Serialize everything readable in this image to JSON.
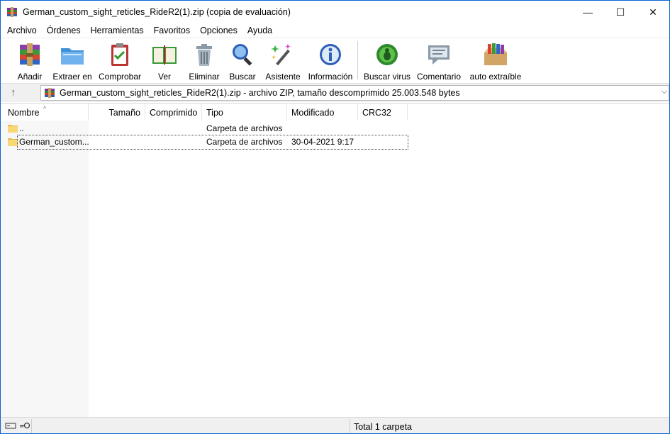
{
  "window": {
    "title": "German_custom_sight_reticles_RideR2(1).zip (copia de evaluación)",
    "controls": {
      "minimize": "—",
      "maximize": "☐",
      "close": "✕"
    }
  },
  "menu": [
    "Archivo",
    "Órdenes",
    "Herramientas",
    "Favoritos",
    "Opciones",
    "Ayuda"
  ],
  "toolbar": [
    {
      "label": "Añadir",
      "icon": "add-archive-icon"
    },
    {
      "label": "Extraer en",
      "icon": "extract-folder-icon"
    },
    {
      "label": "Comprobar",
      "icon": "test-clipboard-icon"
    },
    {
      "label": "Ver",
      "icon": "view-book-icon"
    },
    {
      "label": "Eliminar",
      "icon": "trash-icon"
    },
    {
      "label": "Buscar",
      "icon": "magnifier-icon"
    },
    {
      "label": "Asistente",
      "icon": "wizard-wand-icon"
    },
    {
      "label": "Información",
      "icon": "info-icon"
    },
    {
      "label": "Buscar virus",
      "icon": "virus-scan-icon"
    },
    {
      "label": "Comentario",
      "icon": "comment-icon"
    },
    {
      "label": "auto extraíble",
      "icon": "sfx-box-icon"
    }
  ],
  "address": {
    "up": "↑",
    "text": "German_custom_sight_reticles_RideR2(1).zip - archivo ZIP, tamaño descomprimido 25.003.548 bytes",
    "dropdown": "⌵"
  },
  "columns": {
    "name": "Nombre",
    "size": "Tamaño",
    "packed": "Comprimido",
    "type": "Tipo",
    "modified": "Modificado",
    "crc": "CRC32",
    "sort_indicator": "^"
  },
  "rows": [
    {
      "name": "..",
      "size": "",
      "packed": "",
      "type": "Carpeta de archivos",
      "modified": "",
      "crc": ""
    },
    {
      "name": "German_custom...",
      "size": "",
      "packed": "",
      "type": "Carpeta de archivos",
      "modified": "30-04-2021 9:17",
      "crc": ""
    }
  ],
  "status": {
    "text": "Total 1 carpeta"
  },
  "colors": {
    "accent": "#0a64d6",
    "folder": "#f8d775",
    "folder_dark": "#e3b64a"
  }
}
